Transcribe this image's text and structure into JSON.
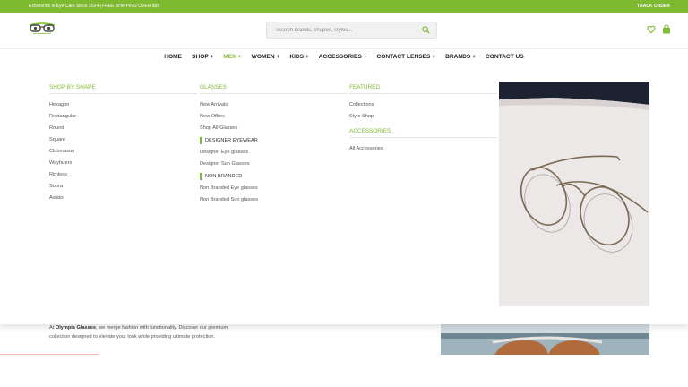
{
  "topbar": {
    "promo": "Excellence in Eye Care Since 2024 | FREE SHIPPING OVER $99",
    "track": "TRACK ORDER"
  },
  "header": {
    "logo_icon": "glasses-logo-icon",
    "search": {
      "placeholder": "Search brands, shapes, styles..."
    },
    "icons": [
      "search-icon",
      "heart-icon",
      "shopping-bag-icon"
    ]
  },
  "nav": {
    "items": [
      {
        "label": "HOME"
      },
      {
        "label": "SHOP +"
      },
      {
        "label": "MEN +"
      },
      {
        "label": "WOMEN +"
      },
      {
        "label": "KIDS +"
      },
      {
        "label": "ACCESSORIES +"
      },
      {
        "label": "CONTACT LENSES +"
      },
      {
        "label": "BRANDS +"
      },
      {
        "label": "CONTACT US"
      }
    ],
    "active": "MEN +"
  },
  "mega": {
    "col1": {
      "heading": "SHOP BY SHAPE",
      "items": [
        "Hexagon",
        "Rectangular",
        "Round",
        "Square",
        "Clubmaster",
        "Wayfarers",
        "Rimless",
        "Supra",
        "Aviator"
      ]
    },
    "col2": {
      "heading": "GLASSES",
      "items": [
        "New Arrivals",
        "New Offers",
        "Shop All Glasses"
      ],
      "designer_heading": "DESIGNER EYEWEAR",
      "designer_items": [
        "Designer Eye glasses",
        "Designer Sun Glasses"
      ],
      "nonbranded_heading": "NON BRANDED",
      "nonbranded_items": [
        "Non Branded Eye glasses",
        "Non Branded Sun glasses"
      ]
    },
    "col3": {
      "heading": "FEATURED",
      "items": [
        "Collections",
        "Style Shop"
      ],
      "accessories_heading": "ACCESSORIES",
      "accessories_items": [
        "All Accessories"
      ]
    }
  },
  "about": {
    "prefix": "At ",
    "brand": "Olympia Glasses",
    "rest": ", we merge fashion with functionality. Discover our premium collection designed to elevate your look while providing ultimate protection."
  },
  "colors": {
    "accent": "#7dba2f",
    "text": "#333333"
  }
}
